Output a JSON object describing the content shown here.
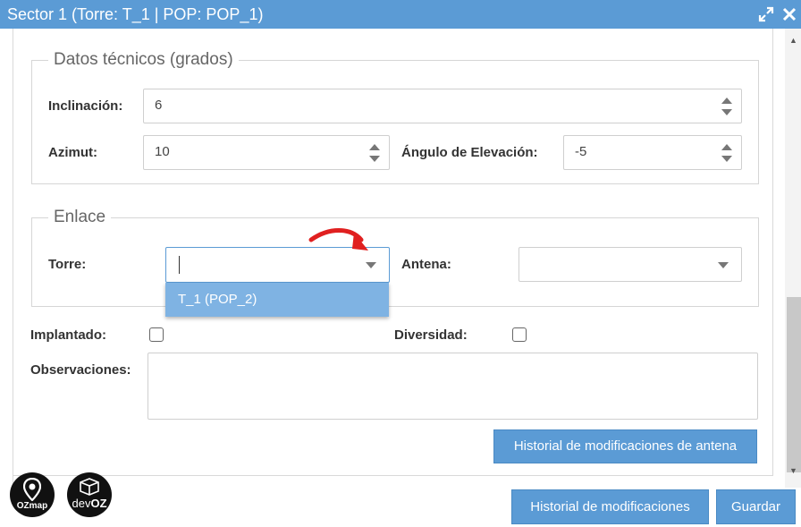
{
  "window": {
    "title": "Sector 1 (Torre: T_1 | POP: POP_1)",
    "titlebar_color": "#5b9bd5"
  },
  "datos_tecnicos": {
    "legend": "Datos técnicos (grados)",
    "inclinacion_label": "Inclinación:",
    "inclinacion_value": "6",
    "azimut_label": "Azimut:",
    "azimut_value": "10",
    "elevacion_label": "Ángulo de Elevación:",
    "elevacion_value": "-5"
  },
  "enlace": {
    "legend": "Enlace",
    "torre_label": "Torre:",
    "torre_value": "",
    "antena_label": "Antena:",
    "antena_value": "",
    "dropdown_options": [
      "T_1 (POP_2)"
    ]
  },
  "flags": {
    "implantado_label": "Implantado:",
    "diversidad_label": "Diversidad:"
  },
  "observaciones": {
    "label": "Observaciones:",
    "value": ""
  },
  "buttons": {
    "historial_antena": "Historial de modificaciones de antena",
    "historial": "Historial de modificaciones",
    "guardar": "Guardar"
  },
  "logos": {
    "ozmap": "OZmap",
    "devoz_prefix": "dev",
    "devoz_suffix": "OZ"
  },
  "icons": {
    "expand": "expand-icon",
    "close": "close-icon",
    "annotation": "red-arrow-icon"
  },
  "colors": {
    "accent": "#5b9bd5",
    "highlight": "#7fb3e3",
    "annotation": "#e02020"
  }
}
